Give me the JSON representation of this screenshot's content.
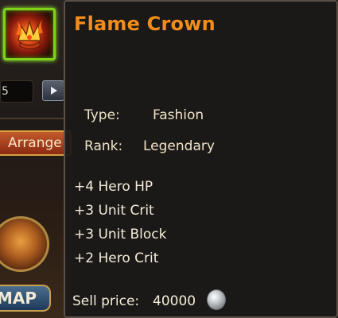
{
  "left_panel": {
    "quantity_value": "5",
    "arrange_label": "Arrange",
    "map_label": "MAP"
  },
  "tooltip": {
    "title": "Flame Crown",
    "type_label": "Type:",
    "type_value": "Fashion",
    "rank_label": "Rank:",
    "rank_value": "Legendary",
    "stats": [
      "+4 Hero HP",
      "+3 Unit Crit",
      "+3 Unit Block",
      "+2 Hero Crit"
    ],
    "sell_label": "Sell price:",
    "sell_value": "40000",
    "currency_icon": "silver-coin-icon"
  },
  "colors": {
    "title": "#f28c1a",
    "slot_border": "#7fd21a",
    "text": "#efe3c8"
  }
}
